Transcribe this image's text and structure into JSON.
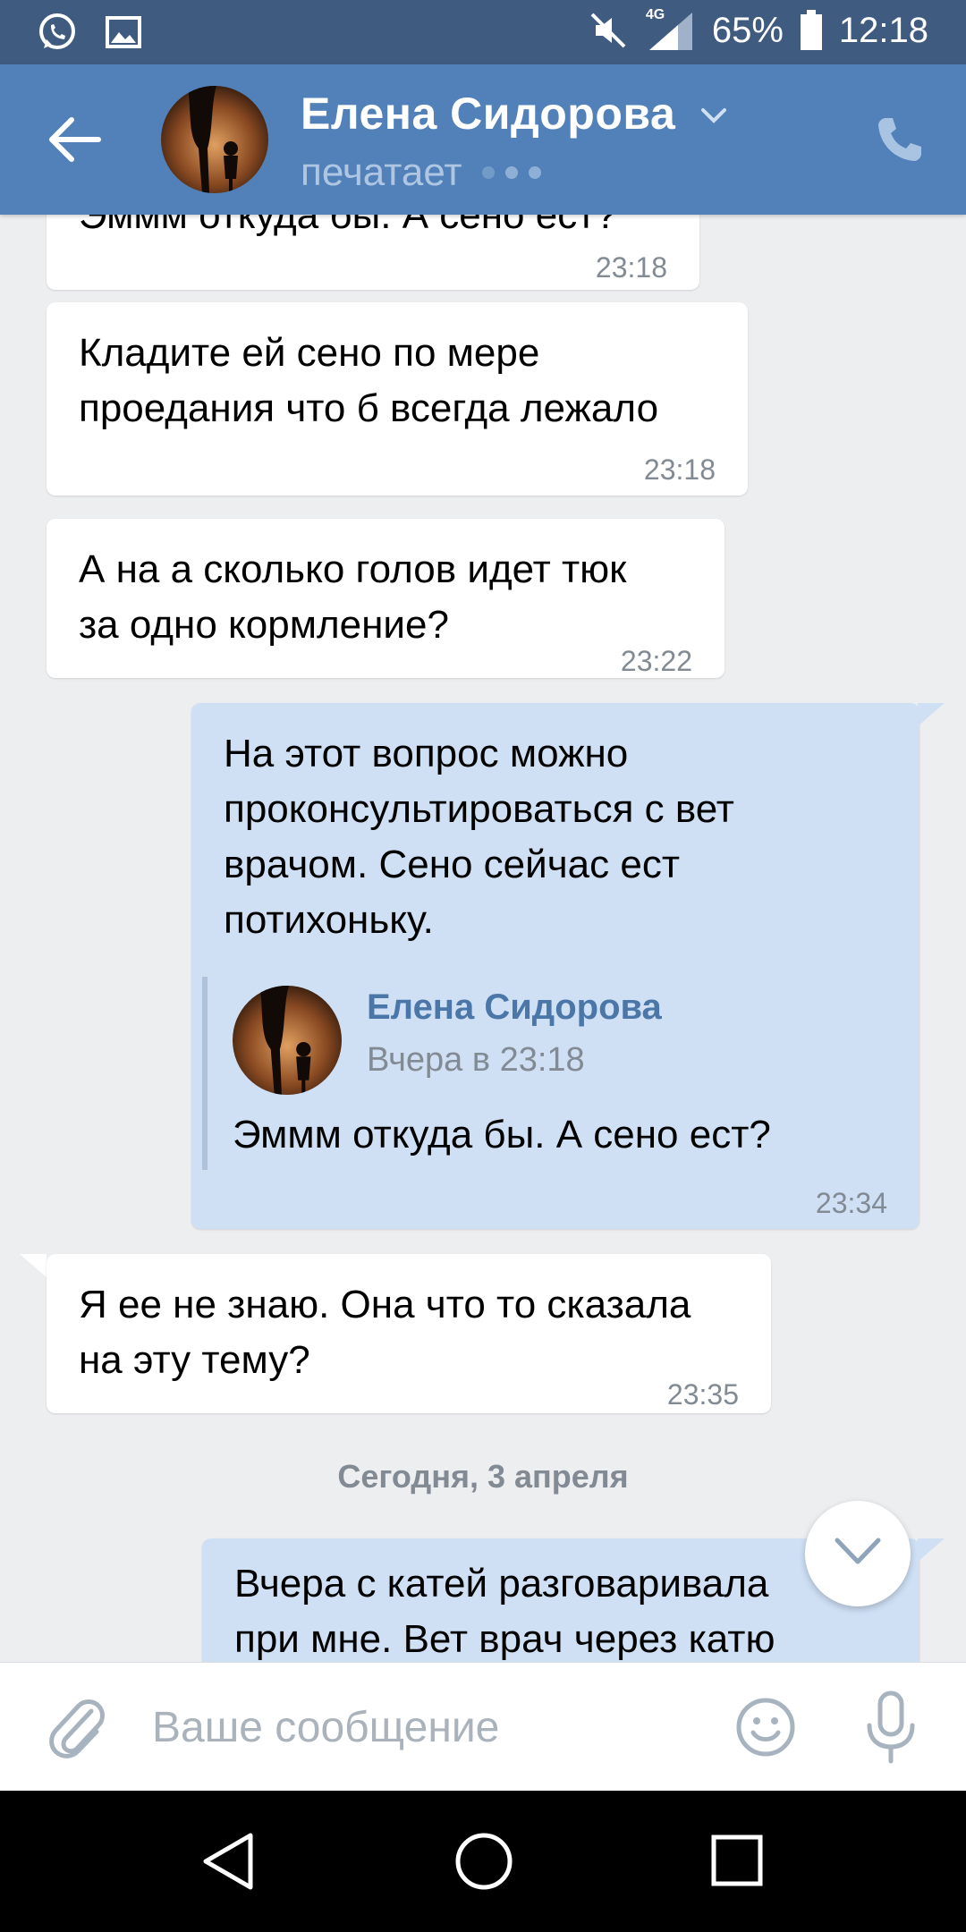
{
  "status_bar": {
    "network": "4G",
    "battery": "65%",
    "time": "12:18",
    "icons": [
      "whatsapp-icon",
      "gallery-icon",
      "mute-icon",
      "signal-icon",
      "battery-icon"
    ]
  },
  "header": {
    "name": "Елена Сидорова",
    "status": "печатает",
    "icons": [
      "back-arrow-icon",
      "chevron-down-icon",
      "phone-icon"
    ]
  },
  "messages": [
    {
      "direction": "in",
      "text": "Эммм откуда бы. А сено ест?",
      "time": "23:18"
    },
    {
      "direction": "in",
      "text": "Кладите ей сено по мере\nпроедания что б всегда лежало",
      "time": "23:18"
    },
    {
      "direction": "in",
      "text": "А на а сколько голов идет тюк\nза одно кормление?",
      "time": "23:22"
    },
    {
      "direction": "out",
      "text": "На этот вопрос можно\nпроконсультироваться с вет\nврачом. Сено сейчас ест\nпотихоньку.",
      "time": "23:34",
      "quote": {
        "name": "Елена Сидорова",
        "date": "Вчера в 23:18",
        "text": "Эммм откуда бы. А сено ест?"
      }
    },
    {
      "direction": "in",
      "text": "Я ее не знаю. Она что то сказала\nна эту тему?",
      "time": "23:35"
    },
    {
      "direction": "out",
      "text": "Вчера с катей разговаривала\nпри мне. Вет врач через катю",
      "time": ""
    }
  ],
  "date_separator": "Сегодня, 3 апреля",
  "composer": {
    "placeholder": "Ваше сообщение",
    "icons": [
      "attach-icon",
      "emoji-icon",
      "mic-icon"
    ]
  },
  "colors": {
    "status_bar": "#3f5c80",
    "header": "#5181b8",
    "background": "#edeef0",
    "incoming_bubble": "#ffffff",
    "outgoing_bubble": "#cfe0f5",
    "accent": "#4a76a8"
  }
}
